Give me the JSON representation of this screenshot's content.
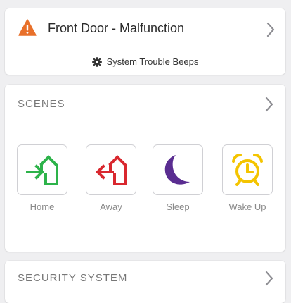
{
  "alert": {
    "icon": "warning-triangle-icon",
    "title": "Front Door - Malfunction",
    "trouble_icon": "gear-icon",
    "trouble_text": "System Trouble Beeps"
  },
  "scenes": {
    "title": "SCENES",
    "items": [
      {
        "label": "Home",
        "icon": "home-arrive-icon",
        "color": "#2db34a"
      },
      {
        "label": "Away",
        "icon": "home-leave-icon",
        "color": "#d9282f"
      },
      {
        "label": "Sleep",
        "icon": "moon-icon",
        "color": "#5a2d91"
      },
      {
        "label": "Wake Up",
        "icon": "alarm-clock-icon",
        "color": "#f4c400"
      }
    ]
  },
  "security": {
    "title": "SECURITY SYSTEM"
  },
  "colors": {
    "warning": "#e8702a",
    "background": "#efeff1",
    "chevron": "#8e8e93"
  }
}
